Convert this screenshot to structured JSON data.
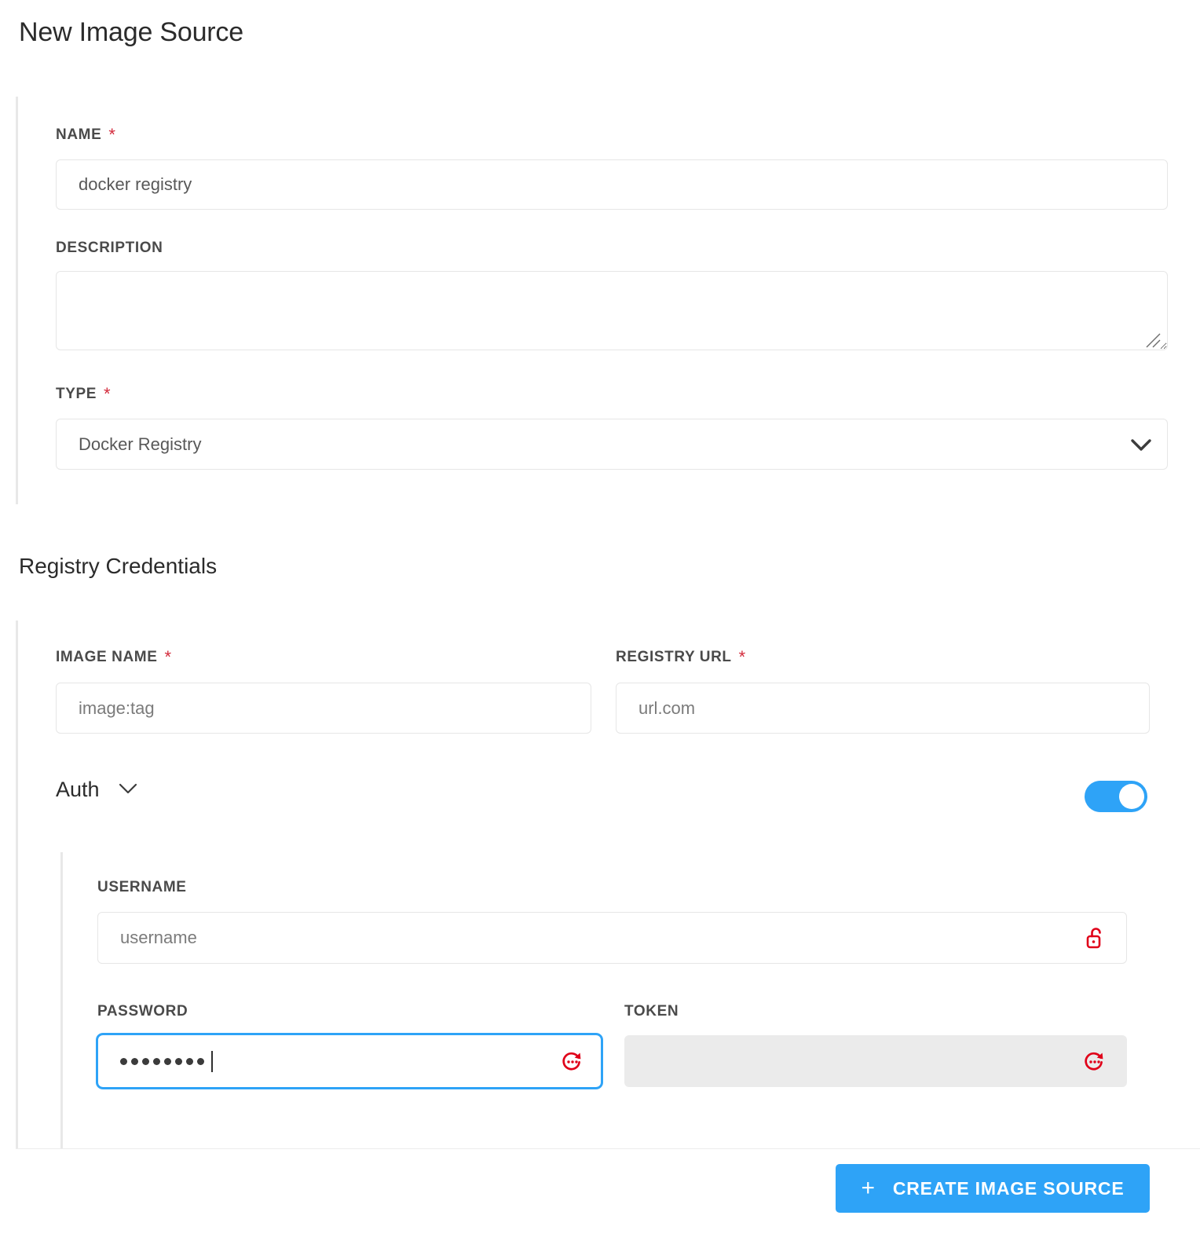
{
  "page": {
    "title": "New Image Source"
  },
  "basic": {
    "name": {
      "label": "NAME",
      "required": "*",
      "value": "docker registry"
    },
    "description": {
      "label": "DESCRIPTION",
      "value": "",
      "placeholder": ""
    },
    "type": {
      "label": "TYPE",
      "required": "*",
      "value": "Docker Registry",
      "chevron_icon": "chevron-down-icon",
      "options": [
        "Docker Registry"
      ]
    }
  },
  "credentials": {
    "heading": "Registry Credentials",
    "image_name": {
      "label": "IMAGE NAME",
      "required": "*",
      "value": "",
      "placeholder": "image:tag"
    },
    "registry_url": {
      "label": "REGISTRY URL",
      "required": "*",
      "value": "",
      "placeholder": "url.com"
    },
    "auth": {
      "label": "Auth",
      "chevron_icon": "chevron-down-icon",
      "toggle_state": "on"
    },
    "username": {
      "label": "USERNAME",
      "value": "",
      "placeholder": "username",
      "icon": "unlocked-padlock-icon"
    },
    "password": {
      "label": "PASSWORD",
      "masked_value": "••••••••",
      "mask_char_count": 8,
      "focused": "true",
      "icon": "rotate-dots-icon"
    },
    "token": {
      "label": "TOKEN",
      "value": "",
      "placeholder": "",
      "disabled": "true",
      "icon": "rotate-dots-icon"
    }
  },
  "footer": {
    "create_button": {
      "label": "CREATE IMAGE SOURCE",
      "plus_icon": "plus-icon"
    }
  },
  "colors": {
    "accent_blue": "#2ea3f7",
    "required_red": "#d32b3c",
    "icon_red": "#e00019",
    "disabled_grey": "#ebebeb",
    "border_grey": "#e6e6e6"
  }
}
